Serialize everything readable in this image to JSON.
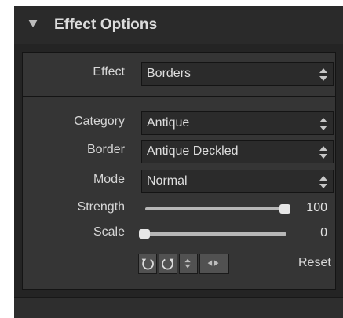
{
  "panel": {
    "title": "Effect Options",
    "collapse_icon": "triangle-down-icon"
  },
  "effect": {
    "label": "Effect",
    "value": "Borders"
  },
  "params": {
    "category": {
      "label": "Category",
      "value": "Antique"
    },
    "border": {
      "label": "Border",
      "value": "Antique Deckled"
    },
    "mode": {
      "label": "Mode",
      "value": "Normal"
    },
    "strength": {
      "label": "Strength",
      "value": "100"
    },
    "scale": {
      "label": "Scale",
      "value": "0"
    }
  },
  "tools": {
    "icons": [
      "rotate-left-icon",
      "rotate-right-icon",
      "flip-vertical-icon",
      "flip-horizontal-icon"
    ],
    "reset_label": "Reset"
  },
  "colors": {
    "panel_bg": "#242424",
    "section_bg": "#353535",
    "text": "#d6d6d6"
  }
}
